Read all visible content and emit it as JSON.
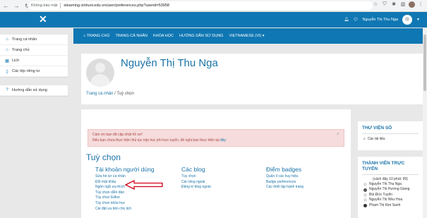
{
  "browser": {
    "warning": "Không bảo mật",
    "url": "elearning.vinhuni.edu.vn/user/preferences.php?userid=53958"
  },
  "topbar": {
    "close_symbol": "✕",
    "username": "Nguyễn Thị Thu Nga"
  },
  "sidebar": {
    "items": [
      {
        "icon": "home-icon",
        "label": "Trang cá nhân"
      },
      {
        "icon": "house-icon",
        "label": "Trang chủ"
      },
      {
        "icon": "calendar-icon",
        "label": "Lịch"
      },
      {
        "icon": "file-icon",
        "label": "Các tệp riêng tư"
      },
      {
        "icon": "help-icon",
        "label": "Hướng dẫn sử dụng"
      }
    ]
  },
  "mainnav": {
    "items": [
      "TRANG CHỦ",
      "TRANG CÁ NHÂN",
      "KHÓA HỌC",
      "HƯỚNG DẪN SỬ DỤNG",
      "VIETNAMESE (VI) ▾"
    ]
  },
  "profile": {
    "name": "Nguyễn Thị Thu Nga",
    "breadcrumb_1": "Trang cá nhân",
    "breadcrumb_sep": "/",
    "breadcrumb_2": "Tuỳ chọn"
  },
  "alert": {
    "line1": "Cám ơn bạn đã cập nhật hồ sơ!",
    "line2": "Nếu bạn chưa thực hiện thủ tục nộp học phí trực tuyến, đề nghị bạn thực hiện tại",
    "link": "đây",
    "close": "×"
  },
  "preferences": {
    "title": "Tuỳ chọn",
    "columns": [
      {
        "title": "Tài khoản người dùng",
        "links": [
          "Sửa hồ sơ cá nhân",
          "Đổi mật khẩu",
          "Ngôn ngữ ưa thích",
          "Tùy chọn diễn đàn",
          "Tùy chọn Editor",
          "Tùy chọn khóa học",
          "Cài đặt ưu tiên cho lịch"
        ]
      },
      {
        "title": "Các blog",
        "links": [
          "Tùy chọn",
          "Các blog ngoài",
          "Đăng kí blog ngoài"
        ]
      },
      {
        "title": "Điểm badges",
        "links": [
          "Quản lí các huy hiệu",
          "Badge preferences",
          "Các thiết lập hành trang"
        ]
      }
    ]
  },
  "library": {
    "title": "THƯ VIỆN SỐ",
    "item": "Các tài liệu"
  },
  "online": {
    "title": "THÀNH VIÊN TRỰC TUYẾN",
    "subtitle": "(cách đây 10 phút: 99)",
    "members": [
      "Nguyễn Thị Thu Nga",
      "Nguyễn Thị Hương Giang",
      "Bùi Đức Tuyến",
      "Nguyễn Thị Như Hoa",
      "Phạm Thị Kim Sanh"
    ]
  },
  "colors": {
    "primary": "#0f77b3",
    "link": "#1a73a8",
    "alert_bg": "#f6dcdc",
    "alert_text": "#a94442",
    "arrow": "#d0021b"
  }
}
